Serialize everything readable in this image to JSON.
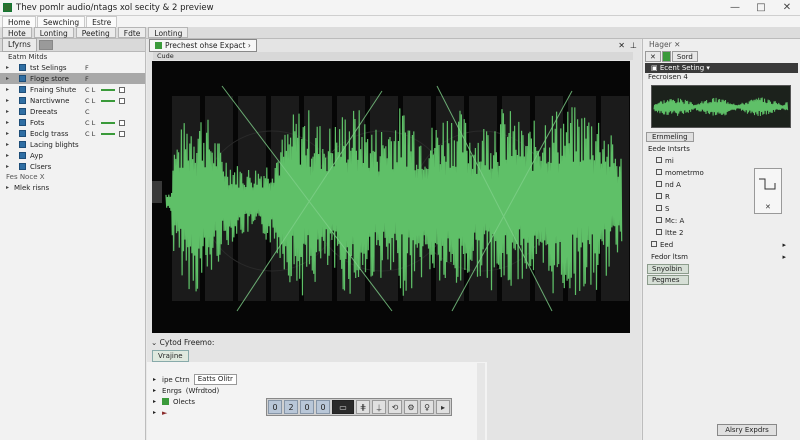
{
  "window": {
    "title": "Thev pomlr audio/ntags xol secity & 2 preview",
    "min": "—",
    "max": "□",
    "close": "✕"
  },
  "menu": [
    "Home",
    "Sewching",
    "Estre"
  ],
  "ribbon": [
    "Hote",
    "Lonting",
    "Peeting",
    "Fdte",
    "Lonting"
  ],
  "left_panel": {
    "tab": "Lfyrns",
    "header": "Eatm Mitds",
    "rows": [
      {
        "label": "tst Selings",
        "val": "F"
      },
      {
        "label": "Floge store",
        "val": "F"
      },
      {
        "label": "Fnaing Shute",
        "val": "C L"
      },
      {
        "label": "Narctivwne",
        "val": "C L"
      },
      {
        "label": "Dreeats",
        "val": "C"
      },
      {
        "label": "Fots",
        "val": "C L"
      },
      {
        "label": "Eoclg trass",
        "val": "C L"
      },
      {
        "label": "Lacing blights",
        "val": ""
      },
      {
        "label": "Ayp",
        "val": ""
      },
      {
        "label": "Clsers",
        "val": ""
      }
    ],
    "separator": "Fes Noce X",
    "last_row": "Mlek risns"
  },
  "center": {
    "tab": "Prechest ohse Expact",
    "subheader": "Cude",
    "lower_title": "Cytod Freemo:",
    "lower_tab": "Vrajine",
    "lower_rows": [
      {
        "a": "ipe Ctrn",
        "b": "Eatts Olitr"
      },
      {
        "a": "Enrgs",
        "b": "(Wfrdtod)"
      },
      {
        "a": "Olects",
        "b": ""
      }
    ],
    "transport": [
      "0",
      "2",
      "0",
      "0"
    ]
  },
  "right_panel": {
    "header": "Hager ✕",
    "tabs": [
      "✕",
      "Sord"
    ],
    "selected": "Ecent Seting",
    "preview_label": "Fecroisen 4",
    "section_button": "Ernmeling",
    "group": "Eede Intsrts",
    "group_rows": [
      "mi",
      "mometrmo",
      "nd A",
      "R",
      "S",
      "Mc: A",
      "ltte 2"
    ],
    "bottom_row": "Eed",
    "fader": "Fedor ltsm",
    "buttons": [
      "Snyolbin",
      "Pegmes"
    ],
    "apply": "Alsry Expdrs"
  },
  "colors": {
    "wave": "#58b860",
    "wave_bg": "#060606",
    "accent": "#3b9a3b"
  }
}
